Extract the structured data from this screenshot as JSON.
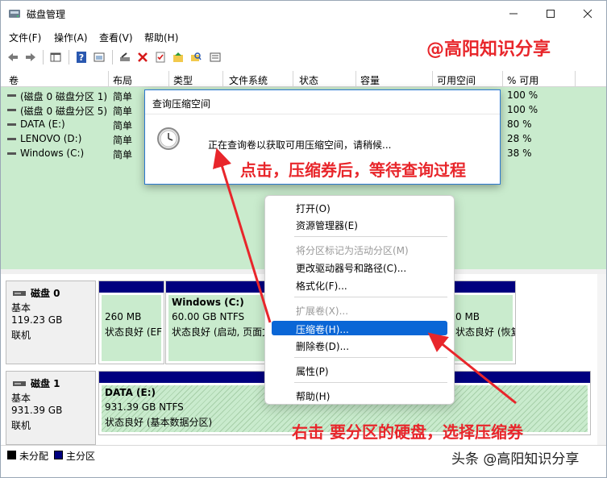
{
  "window": {
    "title": "磁盘管理"
  },
  "menu": [
    "文件(F)",
    "操作(A)",
    "查看(V)",
    "帮助(H)"
  ],
  "watermark_top": "@高阳知识分享",
  "watermark_bottom": "头条 @高阳知识分享",
  "columns": [
    "卷",
    "布局",
    "类型",
    "文件系统",
    "状态",
    "容量",
    "可用空间",
    "% 可用"
  ],
  "volumes": [
    {
      "name": "(磁盘 0 磁盘分区 1)",
      "layout": "简单",
      "pct": "100 %"
    },
    {
      "name": "(磁盘 0 磁盘分区 5)",
      "layout": "简单",
      "pct": "100 %"
    },
    {
      "name": "DATA (E:)",
      "layout": "简单",
      "pct": "80 %"
    },
    {
      "name": "LENOVO (D:)",
      "layout": "简单",
      "pct": "28 %"
    },
    {
      "name": "Windows (C:)",
      "layout": "简单",
      "pct": "38 %"
    }
  ],
  "disks": [
    {
      "name": "磁盘 0",
      "type": "基本",
      "size": "119.23 GB",
      "status": "联机",
      "partitions": [
        {
          "line1": "",
          "line2": "260 MB",
          "line3": "状态良好 (EF"
        },
        {
          "line1": "Windows  (C:)",
          "line2": "60.00 GB NTFS",
          "line3": "状态良好 (启动, 页面文"
        },
        {
          "line1": "",
          "line2": "0 MB",
          "line3": "状态良好 (恢复分"
        }
      ]
    },
    {
      "name": "磁盘 1",
      "type": "基本",
      "size": "931.39 GB",
      "status": "联机",
      "partitions": [
        {
          "line1": "DATA  (E:)",
          "line2": "931.39 GB NTFS",
          "line3": "状态良好 (基本数据分区)"
        }
      ]
    }
  ],
  "legend": [
    {
      "label": "未分配",
      "color": "#000000"
    },
    {
      "label": "主分区",
      "color": "#00007f"
    }
  ],
  "dialog": {
    "title": "查询压缩空间",
    "message": "正在查询卷以获取可用压缩空间，请稍候..."
  },
  "context_menu": [
    {
      "label": "打开(O)",
      "disabled": false
    },
    {
      "label": "资源管理器(E)",
      "disabled": false
    },
    {
      "label": "将分区标记为活动分区(M)",
      "disabled": true
    },
    {
      "label": "更改驱动器号和路径(C)...",
      "disabled": false
    },
    {
      "label": "格式化(F)...",
      "disabled": false
    },
    {
      "label": "扩展卷(X)...",
      "disabled": true
    },
    {
      "label": "压缩卷(H)...",
      "disabled": false,
      "selected": true
    },
    {
      "label": "删除卷(D)...",
      "disabled": false
    },
    {
      "label": "属性(P)",
      "disabled": false
    },
    {
      "label": "帮助(H)",
      "disabled": false
    }
  ],
  "annotations": {
    "top": "点击，压缩券后，等待查询过程",
    "bottom": "右击  要分区的硬盘，选择压缩券"
  },
  "colors": {
    "accent": "#0a66d6",
    "annotation": "#e8262b",
    "partition_bar": "#00007f",
    "volume_bg": "#c9ebcd"
  }
}
